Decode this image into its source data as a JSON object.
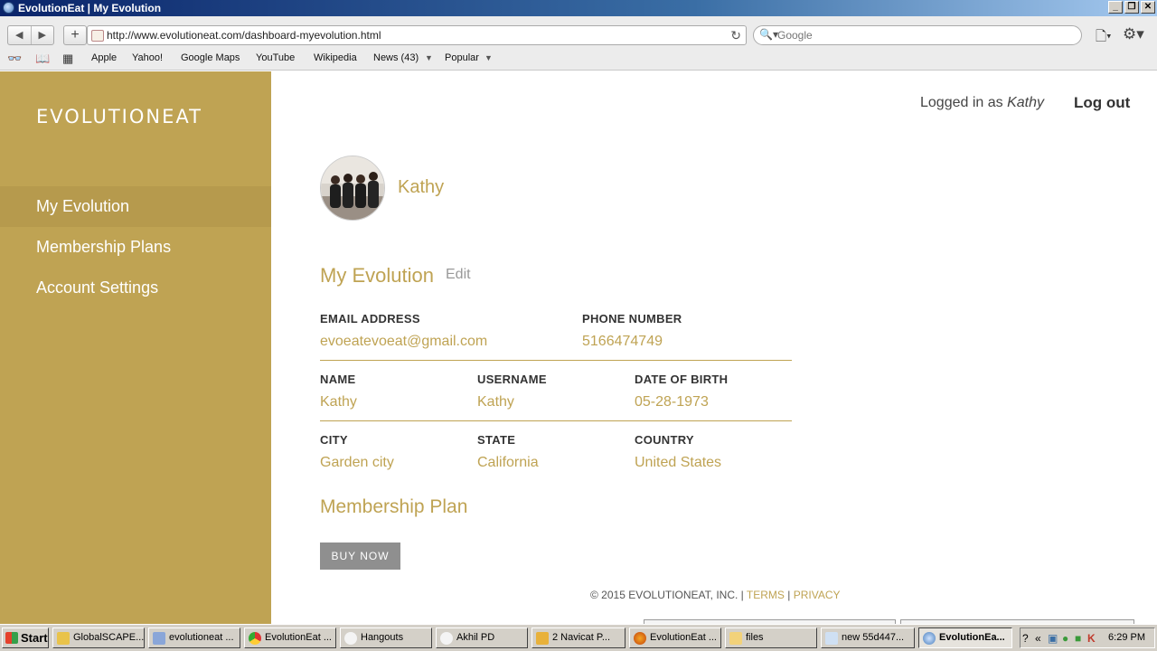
{
  "window": {
    "title": "EvolutionEat | My Evolution"
  },
  "browser": {
    "url": "http://www.evolutioneat.com/dashboard-myevolution.html",
    "search_placeholder": "Google",
    "bookmarks": [
      "Apple",
      "Yahoo!",
      "Google Maps",
      "YouTube",
      "Wikipedia",
      "News (43)",
      "Popular"
    ]
  },
  "sidebar": {
    "logo": "EVOLUTIONEAT",
    "items": [
      {
        "label": "My Evolution"
      },
      {
        "label": "Membership Plans"
      },
      {
        "label": "Account Settings"
      }
    ]
  },
  "header": {
    "logged_in_prefix": "Logged in as ",
    "logged_in_user": "Kathy",
    "logout": "Log out"
  },
  "profile": {
    "name": "Kathy"
  },
  "my_evolution": {
    "title": "My Evolution",
    "edit": "Edit",
    "email_label": "EMAIL ADDRESS",
    "email": "evoeatevoeat@gmail.com",
    "phone_label": "PHONE NUMBER",
    "phone": "5166474749",
    "name_label": "NAME",
    "name": "Kathy",
    "username_label": "USERNAME",
    "username": "Kathy",
    "dob_label": "DATE OF BIRTH",
    "dob": "05-28-1973",
    "city_label": "CITY",
    "city": "Garden city",
    "state_label": "STATE",
    "state": "California",
    "country_label": "COUNTRY",
    "country": "United States"
  },
  "membership": {
    "title": "Membership Plan",
    "buy_now": "BUY NOW"
  },
  "footer": {
    "copyright": "© 2015 EVOLUTIONEAT, INC. | ",
    "terms": "TERMS",
    "sep": " | ",
    "privacy": "PRIVACY"
  },
  "taskbar": {
    "start": "Start",
    "tasks": [
      {
        "label": "GlobalSCAPE..."
      },
      {
        "label": "evolutioneat ..."
      },
      {
        "label": "EvolutionEat ..."
      },
      {
        "label": "Hangouts"
      },
      {
        "label": "Akhil PD"
      },
      {
        "label": "2 Navicat P..."
      },
      {
        "label": "EvolutionEat ..."
      },
      {
        "label": "files"
      },
      {
        "label": "new 55d447..."
      },
      {
        "label": "EvolutionEa..."
      }
    ],
    "clock": "6:29 PM"
  }
}
